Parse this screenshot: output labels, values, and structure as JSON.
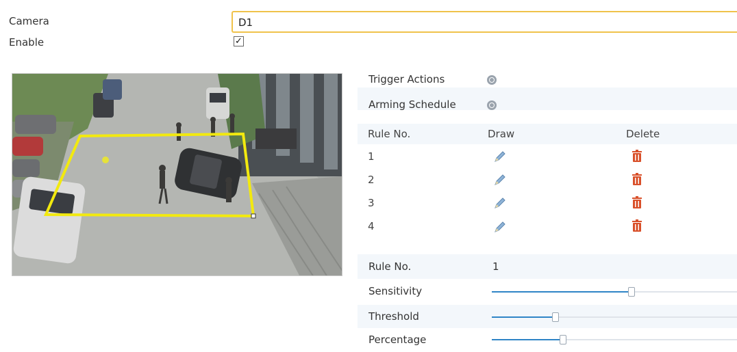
{
  "camera": {
    "label": "Camera",
    "value": "D1"
  },
  "enable": {
    "label": "Enable",
    "checked": true,
    "check_glyph": "✓"
  },
  "actions": {
    "trigger_label": "Trigger Actions",
    "schedule_label": "Arming Schedule"
  },
  "rules_table": {
    "headers": {
      "rule_no": "Rule No.",
      "draw": "Draw",
      "delete": "Delete"
    },
    "rows": [
      "1",
      "2",
      "3",
      "4"
    ]
  },
  "settings": {
    "rule_no_label": "Rule No.",
    "rule_no_value": "1",
    "sensitivity_label": "Sensitivity",
    "sensitivity_level": 0.57,
    "threshold_label": "Threshold",
    "threshold_level": 0.26,
    "percentage_label": "Percentage",
    "percentage_level": 0.29
  },
  "colors": {
    "accent": "#2e84c6",
    "rule_box": "#f2e90f",
    "delete_icon": "#d9502a",
    "input_border": "#f0c24a"
  },
  "icons": {
    "gear": "gear-icon",
    "pencil": "pencil-icon",
    "trash": "trash-icon"
  }
}
